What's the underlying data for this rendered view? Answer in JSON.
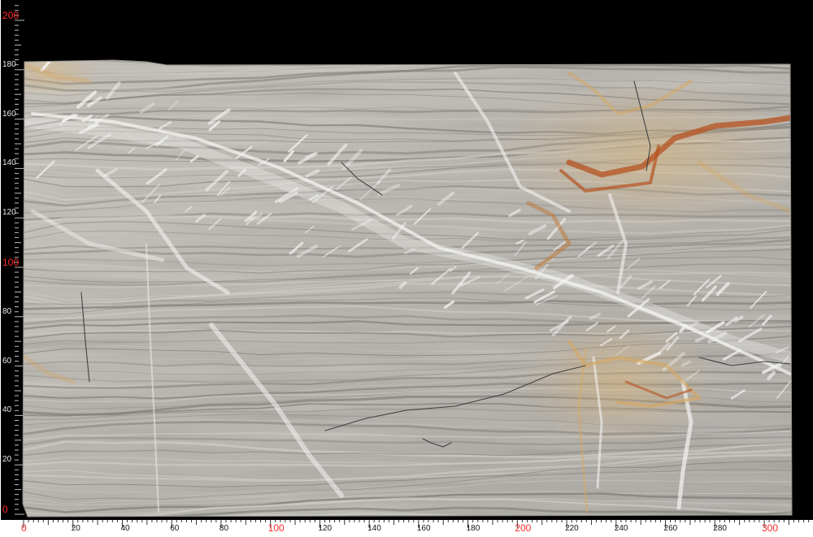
{
  "image": {
    "subject": "stone-slab",
    "colors": {
      "background": "#000000",
      "slab_base": "#b9b5ae",
      "slab_band_dark": "#7d7b77",
      "slab_vein_white": "#f4f4f2",
      "slab_vein_gold": "#d5a764",
      "slab_vein_rust": "#b5521f",
      "ruler_strip": "#ffffff",
      "label_red": "#ff2a2a",
      "label_black": "#111111"
    }
  },
  "ruler": {
    "vertical_labels": [
      "200",
      "180",
      "160",
      "140",
      "120",
      "100",
      "80",
      "60",
      "40",
      "20",
      "0"
    ],
    "horizontal_labels": [
      "0",
      "20",
      "40",
      "60",
      "80",
      "100",
      "120",
      "140",
      "160",
      "180",
      "200",
      "220",
      "240",
      "260",
      "280",
      "300"
    ],
    "highlight_every": "100"
  }
}
